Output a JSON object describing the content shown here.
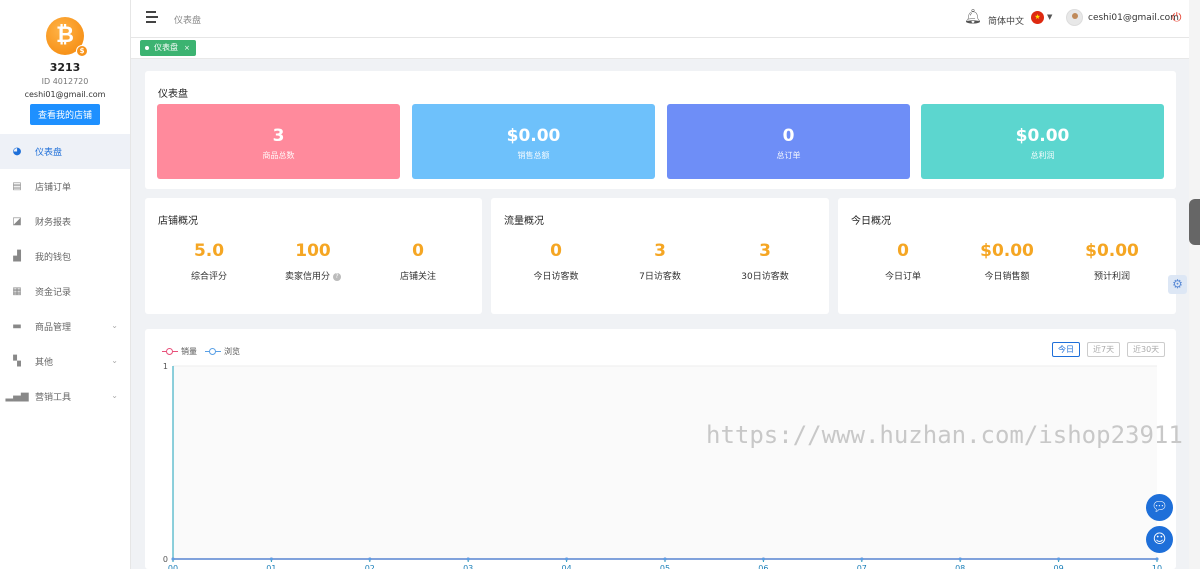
{
  "profile": {
    "avatar_symbol": "₿",
    "shop_name": "3213",
    "shop_id": "ID 4012720",
    "email": "ceshi01@gmail.com",
    "view_shop_label": "查看我的店铺"
  },
  "sidebar": {
    "items": [
      {
        "label": "仪表盘",
        "icon": "dashboard-icon"
      },
      {
        "label": "店铺订单",
        "icon": "clipboard-icon"
      },
      {
        "label": "财务报表",
        "icon": "chart-line-icon"
      },
      {
        "label": "我的钱包",
        "icon": "wallet-icon"
      },
      {
        "label": "资金记录",
        "icon": "file-icon"
      },
      {
        "label": "商品管理",
        "icon": "briefcase-icon"
      },
      {
        "label": "其他",
        "icon": "grid-icon"
      },
      {
        "label": "营销工具",
        "icon": "bar-chart-icon"
      }
    ]
  },
  "header": {
    "title": "仪表盘",
    "language": "简体中文",
    "user_email": "ceshi01@gmail.com"
  },
  "tabs": [
    {
      "label": "仪表盘",
      "close": "×"
    }
  ],
  "summary": {
    "title": "仪表盘",
    "stats": [
      {
        "value": "3",
        "label": "商品总数",
        "color": "#ff8a9c"
      },
      {
        "value": "$0.00",
        "label": "销售总额",
        "color": "#6ec1fb"
      },
      {
        "value": "0",
        "label": "总订单",
        "color": "#6e8ef7"
      },
      {
        "value": "$0.00",
        "label": "总利润",
        "color": "#5cd6cf"
      }
    ]
  },
  "shop_overview": {
    "title": "店铺概况",
    "items": [
      {
        "value": "5.0",
        "label": "综合评分"
      },
      {
        "value": "100",
        "label": "卖家信用分"
      },
      {
        "value": "0",
        "label": "店铺关注"
      }
    ]
  },
  "traffic_overview": {
    "title": "流量概况",
    "items": [
      {
        "value": "0",
        "label": "今日访客数"
      },
      {
        "value": "3",
        "label": "7日访客数"
      },
      {
        "value": "3",
        "label": "30日访客数"
      }
    ]
  },
  "today_overview": {
    "title": "今日概况",
    "items": [
      {
        "value": "0",
        "label": "今日订单"
      },
      {
        "value": "$0.00",
        "label": "今日销售额"
      },
      {
        "value": "$0.00",
        "label": "预计利润"
      }
    ]
  },
  "chart": {
    "range_buttons": [
      "今日",
      "近7天",
      "近30天"
    ],
    "active_range": "今日"
  },
  "chart_data": {
    "type": "line",
    "x": [
      "00",
      "01",
      "02",
      "03",
      "04",
      "05",
      "06",
      "07",
      "08",
      "09",
      "10"
    ],
    "series": [
      {
        "name": "销量",
        "values": [
          0,
          0,
          0,
          0,
          0,
          0,
          0,
          0,
          0,
          0,
          0
        ],
        "color": "#e8507a"
      },
      {
        "name": "浏览",
        "values": [
          0,
          0,
          0,
          0,
          0,
          0,
          0,
          0,
          0,
          0,
          0
        ],
        "color": "#5aa0e6"
      }
    ],
    "yticks": [
      "1",
      "0"
    ],
    "ylim": [
      0,
      1
    ],
    "legend": "top-left"
  },
  "watermark": "https://www.huzhan.com/ishop23911"
}
